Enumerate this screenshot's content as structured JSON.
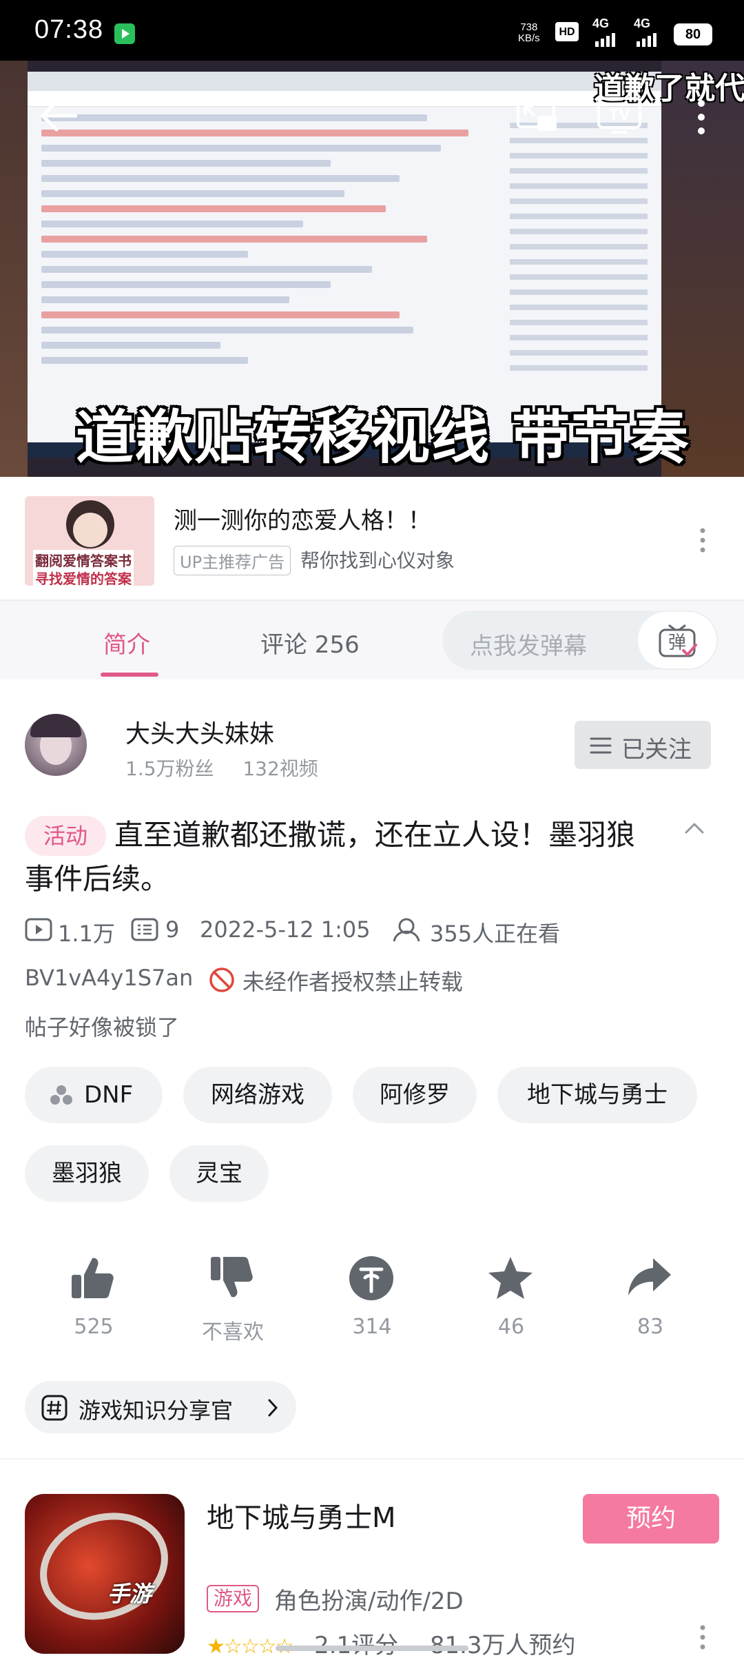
{
  "status_bar": {
    "time": "07:38",
    "net_speed_value": "738",
    "net_speed_unit": "KB/s",
    "hd_label": "HD",
    "signal1": "4G",
    "signal2": "4G",
    "battery": "80"
  },
  "video": {
    "overlay_caption": "道歉贴转移视线 带节奏",
    "overlay_top_right": "道歉了就代"
  },
  "ad": {
    "thumb_text_1": "翻阅爱情答案书",
    "thumb_text_2": "寻找爱情的答案",
    "title": "测一测你的恋爱人格！！",
    "badge": "UP主推荐广告",
    "subtitle": "帮你找到心仪对象"
  },
  "tabs": {
    "intro": "简介",
    "comments": "评论 256",
    "danmaku_placeholder": "点我发弹幕",
    "danmaku_button": "弹"
  },
  "uploader": {
    "name": "大头大头妹妹",
    "fans": "1.5万粉丝",
    "videos": "132视频",
    "follow_label": "已关注"
  },
  "video_info": {
    "badge": "活动",
    "title": "直至道歉都还撒谎，还在立人设！墨羽狼事件后续。",
    "views": "1.1万",
    "danmaku_count": "9",
    "date": "2022-5-12 1:05",
    "watching": "355人正在看",
    "bvid": "BV1vA4y1S7an",
    "no_repost": "未经作者授权禁止转载",
    "description": "帖子好像被锁了"
  },
  "tags": [
    "DNF",
    "网络游戏",
    "阿修罗",
    "地下城与勇士",
    "墨羽狼",
    "灵宝"
  ],
  "actions": {
    "like": "525",
    "dislike": "不喜欢",
    "coin": "314",
    "favorite": "46",
    "share": "83"
  },
  "topic": "游戏知识分享官",
  "game_card": {
    "name": "地下城与勇士M",
    "reserve": "预约",
    "tag": "游戏",
    "genre": "角色扮演/动作/2D",
    "rating": "2.1评分",
    "reservations": "81.3万人预约",
    "icon_text": "手游"
  },
  "colors": {
    "accent_pink": "#e05888",
    "reserve_pink": "#f57aa0",
    "muted": "#9499a0"
  }
}
